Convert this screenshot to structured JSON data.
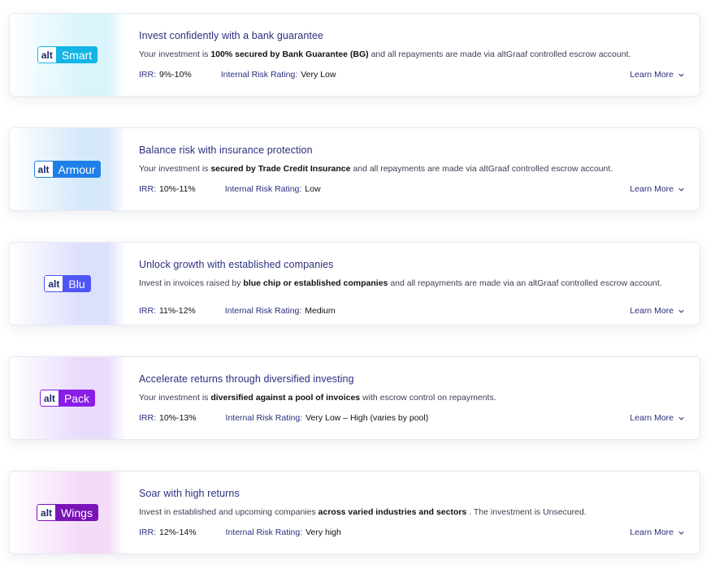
{
  "products": [
    {
      "badge_prefix": "alt",
      "badge_name": "Smart",
      "badge_color": "#14b4e6",
      "gradient_color": "#d9f4fb",
      "title": "Invest confidently with a bank guarantee",
      "desc_before": "Your investment is ",
      "desc_bold": "100% secured by Bank Guarantee (BG)",
      "desc_after": " and all repayments are made via altGraaf controlled escrow account.",
      "irr_label": "IRR:",
      "irr_value": "9%-10%",
      "risk_label": "Internal Risk Rating:",
      "risk_value": "Very Low",
      "learn_more": "Learn More"
    },
    {
      "badge_prefix": "alt",
      "badge_name": "Armour",
      "badge_color": "#1e7fe8",
      "gradient_color": "#d6e9fb",
      "title": "Balance risk with insurance protection",
      "desc_before": "Your investment is ",
      "desc_bold": "secured by Trade Credit Insurance",
      "desc_after": " and all repayments are made via altGraaf controlled escrow account.",
      "irr_label": "IRR:",
      "irr_value": "10%-11%",
      "risk_label": "Internal Risk Rating:",
      "risk_value": "Low",
      "learn_more": "Learn More"
    },
    {
      "badge_prefix": "alt",
      "badge_name": "Blu",
      "badge_color": "#4f55f5",
      "gradient_color": "#dde0fd",
      "title": "Unlock growth with established companies",
      "desc_before": "Invest in invoices raised by ",
      "desc_bold": "blue chip or established companies",
      "desc_after": " and all repayments are made via an altGraaf controlled escrow account.",
      "irr_label": "IRR:",
      "irr_value": "11%-12%",
      "risk_label": "Internal Risk Rating:",
      "risk_value": "Medium",
      "learn_more": "Learn More"
    },
    {
      "badge_prefix": "alt",
      "badge_name": "Pack",
      "badge_color": "#8a1ee6",
      "gradient_color": "#e9dbfc",
      "title": "Accelerate returns through diversified investing",
      "desc_before": "Your investment is ",
      "desc_bold": "diversified against a pool of invoices",
      "desc_after": " with escrow control on repayments.",
      "irr_label": "IRR:",
      "irr_value": "10%-13%",
      "risk_label": "Internal Risk Rating:",
      "risk_value": "Very Low – High (varies by pool)",
      "learn_more": "Learn More"
    },
    {
      "badge_prefix": "alt",
      "badge_name": "Wings",
      "badge_color": "#7a13b8",
      "gradient_color": "#f3dcf7",
      "title": "Soar with high returns",
      "desc_before": "Invest in established and upcoming companies ",
      "desc_bold": "across varied industries and sectors",
      "desc_after": " . The investment is Unsecured.",
      "irr_label": "IRR:",
      "irr_value": "12%-14%",
      "risk_label": "Internal Risk Rating:",
      "risk_value": "Very high",
      "learn_more": "Learn More"
    }
  ]
}
